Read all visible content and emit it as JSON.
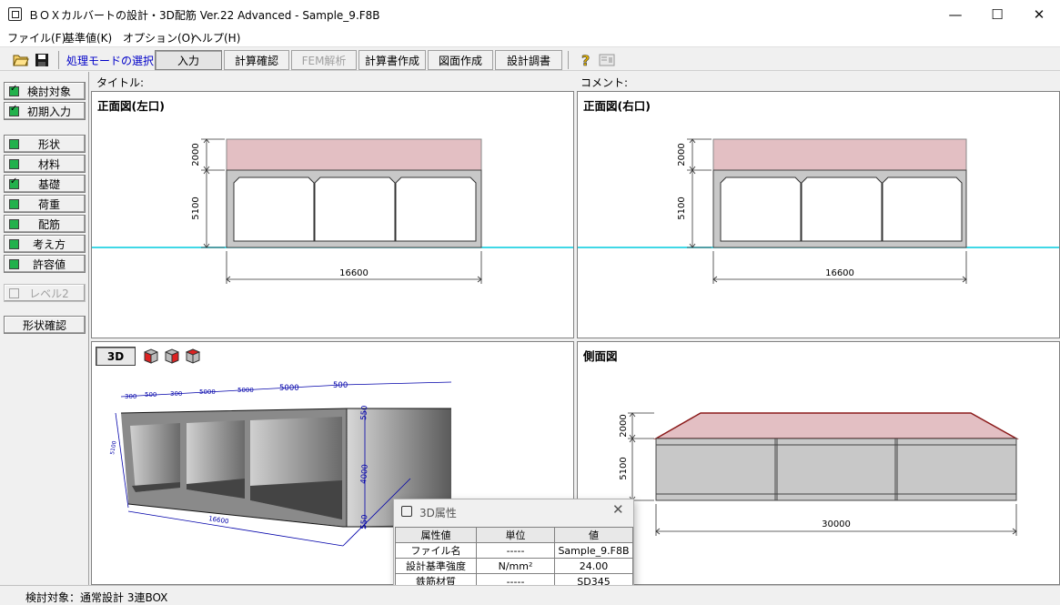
{
  "window": {
    "title": "ＢＯＸカルバートの設計・3D配筋 Ver.22 Advanced - Sample_9.F8B"
  },
  "menu": [
    "ファイル(F)",
    "基準値(K)",
    "オプション(O)",
    "ヘルプ(H)"
  ],
  "toolbar": {
    "mode_label": "処理モードの選択",
    "modes": [
      "入力",
      "計算確認",
      "FEM解析",
      "計算書作成",
      "図面作成",
      "設計調書"
    ],
    "active_mode": "入力",
    "disabled_mode": "FEM解析"
  },
  "left_buttons": [
    {
      "label": "検討対象",
      "checked": true
    },
    {
      "label": "初期入力",
      "checked": true
    },
    {
      "label": "形状",
      "checked": false
    },
    {
      "label": "材料",
      "checked": false
    },
    {
      "label": "基礎",
      "checked": true
    },
    {
      "label": "荷重",
      "checked": false
    },
    {
      "label": "配筋",
      "checked": false
    },
    {
      "label": "考え方",
      "checked": false
    },
    {
      "label": "許容値",
      "checked": false
    }
  ],
  "level2": "レベル2",
  "shape_check": "形状確認",
  "header": {
    "title_label": "タイトル:",
    "comment_label": "コメント:"
  },
  "views": {
    "front_left": {
      "title": "正面図(左口)",
      "dims": {
        "top": "2000",
        "height": "5100",
        "width": "16600"
      }
    },
    "front_right": {
      "title": "正面図(右口)",
      "dims": {
        "top": "2000",
        "height": "5100",
        "width": "16600"
      }
    },
    "side": {
      "title": "側面図",
      "dims": {
        "top": "2000",
        "height": "5100",
        "width": "30000"
      }
    },
    "view3d": {
      "button": "3D",
      "dims_top": [
        "300",
        "5000",
        "300",
        "5000",
        "500"
      ],
      "dims_top_small": [
        "500",
        "5000"
      ],
      "dim_right_top": "550",
      "dim_right_mid": "4000",
      "dim_right_bot": "550",
      "dim_bottom": "16600",
      "dim_left": "5100"
    }
  },
  "props_dialog": {
    "title": "3D属性",
    "headers": [
      "属性値",
      "単位",
      "値"
    ],
    "rows": [
      {
        "name": "ファイル名",
        "unit": "-----",
        "value": "Sample_9.F8B"
      },
      {
        "name": "設計基準強度",
        "unit": "N/mm²",
        "value": "24.00"
      },
      {
        "name": "鉄筋材質",
        "unit": "-----",
        "value": "SD345"
      }
    ]
  },
  "status": {
    "text": "検討対象：通常設計 3連BOX"
  },
  "colors": {
    "fill_soil": "#e3bfc3",
    "concrete": "#c8c8c8",
    "ground_line": "#00ccdd",
    "check_green": "#22b14c"
  }
}
